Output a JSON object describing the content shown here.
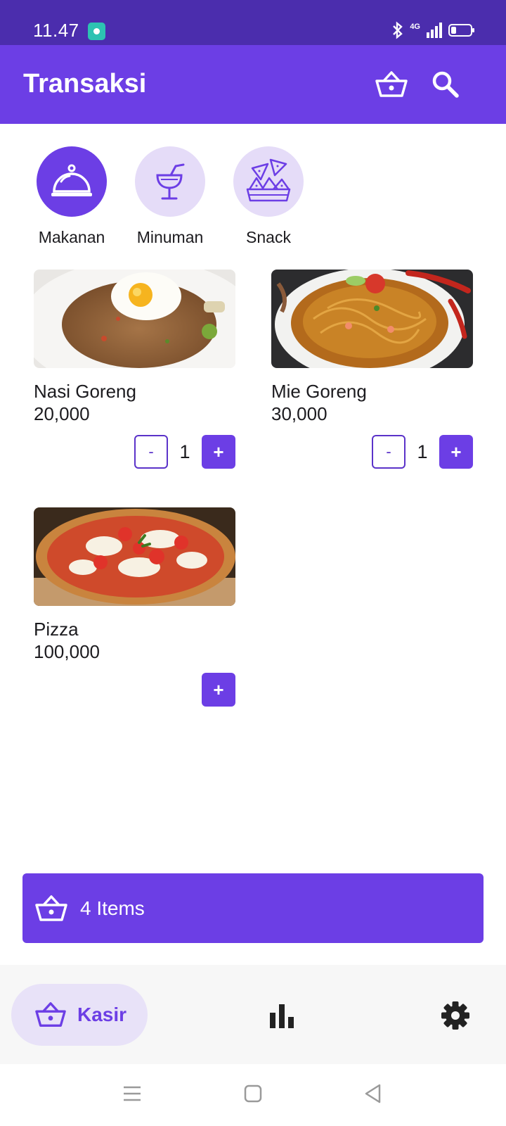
{
  "status_bar": {
    "time": "11.47",
    "network": "4G"
  },
  "app_bar": {
    "title": "Transaksi"
  },
  "categories": [
    {
      "label": "Makanan",
      "icon": "cloche-icon",
      "selected": true
    },
    {
      "label": "Minuman",
      "icon": "drink-icon",
      "selected": false
    },
    {
      "label": "Snack",
      "icon": "nachos-icon",
      "selected": false
    }
  ],
  "products": [
    {
      "name": "Nasi Goreng",
      "price": "20,000",
      "qty": "1",
      "minus": "-",
      "plus": "+"
    },
    {
      "name": "Mie Goreng",
      "price": "30,000",
      "qty": "1",
      "minus": "-",
      "plus": "+"
    },
    {
      "name": "Pizza",
      "price": "100,000",
      "plus": "+"
    }
  ],
  "cart": {
    "label": "4 Items"
  },
  "bottom_nav": {
    "kasir_label": "Kasir",
    "items": [
      "basket-icon",
      "bar-chart-icon",
      "gear-icon"
    ]
  },
  "colors": {
    "primary": "#6c3ee5",
    "status_bar": "#4b2dad",
    "category_bg": "#e5dcf8",
    "nav_active_bg": "#e8e2f8"
  }
}
